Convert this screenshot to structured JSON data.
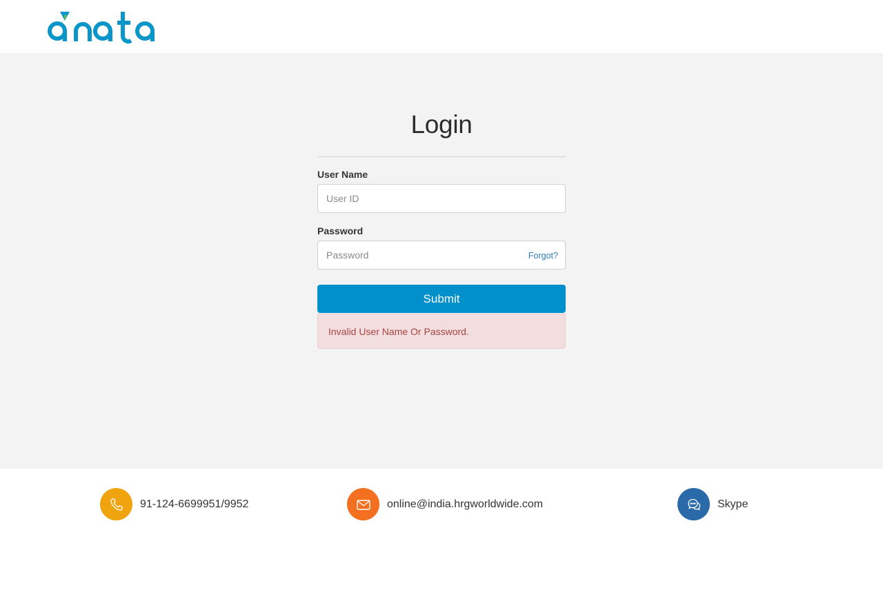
{
  "brand": {
    "logo_text": "dnata",
    "logo_color": "#0b96c9",
    "accent_color": "#7ac143"
  },
  "login": {
    "title": "Login",
    "username_label": "User Name",
    "username_placeholder": "User ID",
    "password_label": "Password",
    "password_placeholder": "Password",
    "forgot_label": "Forgot?",
    "submit_label": "Submit",
    "error_message": "Invalid User Name Or Password.",
    "submit_color": "#0290cc",
    "error_bg_color": "#f2dede",
    "error_text_color": "#a94442"
  },
  "footer": {
    "phone": {
      "icon": "phone-icon",
      "text": "91-124-6699951/9952",
      "color": "#eea30f"
    },
    "email": {
      "icon": "mail-icon",
      "text": "online@india.hrgworldwide.com",
      "color": "#f37021"
    },
    "skype": {
      "icon": "chat-icon",
      "text": "Skype",
      "color": "#2b6aa8"
    }
  }
}
